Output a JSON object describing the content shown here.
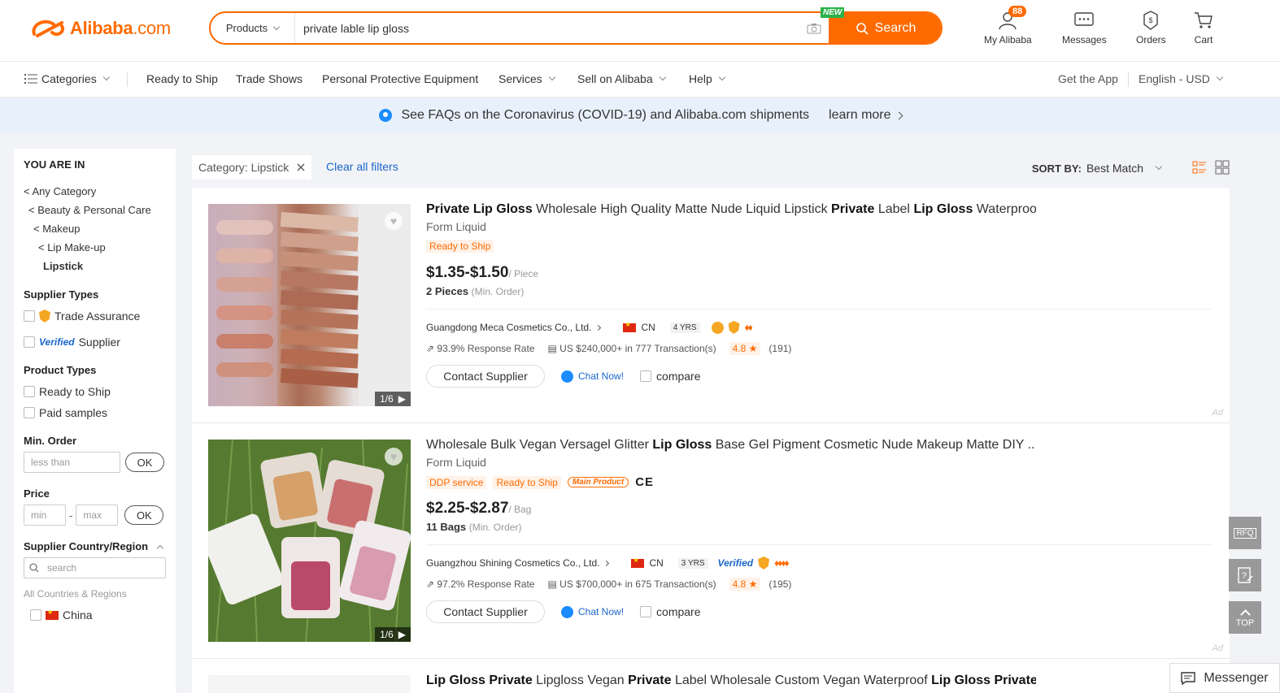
{
  "header": {
    "logo_text": "Alibaba",
    "logo_domain": ".com",
    "search_category": "Products",
    "search_value": "private lable lip gloss",
    "new_badge": "NEW",
    "search_button": "Search",
    "nav": [
      {
        "label": "My Alibaba",
        "badge": "88"
      },
      {
        "label": "Messages"
      },
      {
        "label": "Orders"
      },
      {
        "label": "Cart"
      }
    ]
  },
  "catnav": {
    "categories": "Categories",
    "items": [
      "Ready to Ship",
      "Trade Shows",
      "Personal Protective Equipment",
      "Services",
      "Sell on Alibaba",
      "Help"
    ],
    "get_app": "Get the App",
    "language": "English - USD"
  },
  "banner": {
    "text": "See FAQs on the Coronavirus (COVID-19) and Alibaba.com shipments",
    "link": "learn more"
  },
  "sidebar": {
    "you_are_in": "YOU ARE IN",
    "crumbs": [
      "< Any Category",
      "< Beauty & Personal Care",
      "< Makeup",
      "< Lip Make-up",
      "Lipstick"
    ],
    "supplier_types": "Supplier Types",
    "trade_assurance": "Trade Assurance",
    "verified": "Verified",
    "supplier": "Supplier",
    "product_types": "Product Types",
    "ready_to_ship": "Ready to Ship",
    "paid_samples": "Paid samples",
    "min_order": "Min. Order",
    "less_than": "less than",
    "ok": "OK",
    "price": "Price",
    "min": "min",
    "max": "max",
    "country_region": "Supplier Country/Region",
    "search_placeholder": "search",
    "all_countries": "All Countries & Regions",
    "china": "China"
  },
  "filterbar": {
    "chip": "Category: Lipstick",
    "clear": "Clear all filters",
    "sort_label": "SORT BY:",
    "sort_value": "Best Match"
  },
  "products": [
    {
      "title_parts": [
        [
          "Private Lip Gloss",
          true
        ],
        [
          " Wholesale High Quality Matte Nude Liquid Lipstick ",
          false
        ],
        [
          "Private",
          true
        ],
        [
          " Label ",
          false
        ],
        [
          "Lip Gloss",
          true
        ],
        [
          " Waterproo...",
          false
        ]
      ],
      "subtitle": "Form Liquid",
      "tags": [
        "Ready to Ship"
      ],
      "price": "$1.35-$1.50",
      "unit": "/ Piece",
      "moq": "2 Pieces",
      "moq_label": "(Min. Order)",
      "supplier": "Guangdong Meca Cosmetics Co., Ltd.",
      "country": "CN",
      "years": "4 YRS",
      "response": "93.9% Response Rate",
      "transactions": "US $240,000+ in 777 Transaction(s)",
      "rating": "4.8 ★",
      "reviews": "(191)",
      "img_count": "1/6"
    },
    {
      "title_parts": [
        [
          "Wholesale Bulk Vegan Versagel Glitter ",
          false
        ],
        [
          "Lip Gloss",
          true
        ],
        [
          " Base Gel Pigment Cosmetic Nude Makeup Matte DIY ...",
          false
        ]
      ],
      "subtitle": "Form Liquid",
      "tags": [
        "DDP service",
        "Ready to Ship"
      ],
      "main_product": "Main Product",
      "ce": "CE",
      "price": "$2.25-$2.87",
      "unit": "/ Bag",
      "moq": "11 Bags",
      "moq_label": "(Min. Order)",
      "supplier": "Guangzhou Shining Cosmetics Co., Ltd.",
      "country": "CN",
      "years": "3 YRS",
      "verified": "Verified",
      "response": "97.2% Response Rate",
      "transactions": "US $700,000+ in 675 Transaction(s)",
      "rating": "4.8 ★",
      "reviews": "(195)",
      "img_count": "1/6"
    },
    {
      "title_parts": [
        [
          "Lip Gloss Private",
          true
        ],
        [
          " Lipgloss Vegan ",
          false
        ],
        [
          "Private",
          true
        ],
        [
          " Label Wholesale Custom Vegan Waterproof ",
          false
        ],
        [
          "Lip Gloss Private",
          true
        ],
        [
          " ...",
          false
        ]
      ]
    }
  ],
  "actions": {
    "contact": "Contact Supplier",
    "chat": "Chat Now!",
    "compare": "compare",
    "ad": "Ad"
  },
  "floating": {
    "rfq": "RFQ",
    "top": "TOP",
    "messenger": "Messenger"
  },
  "colors": {
    "brand": "#ff6a00",
    "link": "#1a66c9"
  }
}
